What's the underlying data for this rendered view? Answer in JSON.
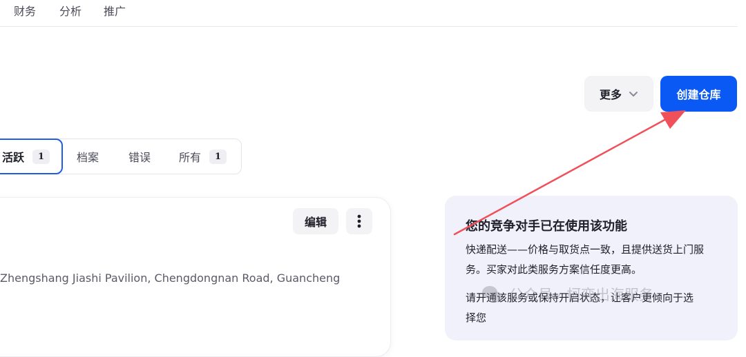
{
  "topnav": {
    "items": [
      "财务",
      "分析",
      "推广"
    ]
  },
  "actions": {
    "more_label": "更多",
    "create_label": "创建仓库"
  },
  "tabs": [
    {
      "label": "活跃",
      "count": "1"
    },
    {
      "label": "档案"
    },
    {
      "label": "错误"
    },
    {
      "label": "所有",
      "count": "1"
    }
  ],
  "warehouse_card": {
    "edit_label": "编辑",
    "address": "Zhengshang Jiashi Pavilion, Chengdongnan Road, Guancheng"
  },
  "promo": {
    "title": "您的竞争对手已在使用该功能",
    "body": "快递配送——价格与取货点一致，且提供送货上门服务。买家对此类服务方案信任度更高。",
    "cta_text": "请开通该服务或保持开启状态，让客户更倾向于选择您"
  },
  "watermark": {
    "text": "公众号 · 柯弈出海服务"
  },
  "colors": {
    "primary": "#0a59f5",
    "annotation_arrow": "#f0505a",
    "promo_bg": "#f1f1fb"
  }
}
